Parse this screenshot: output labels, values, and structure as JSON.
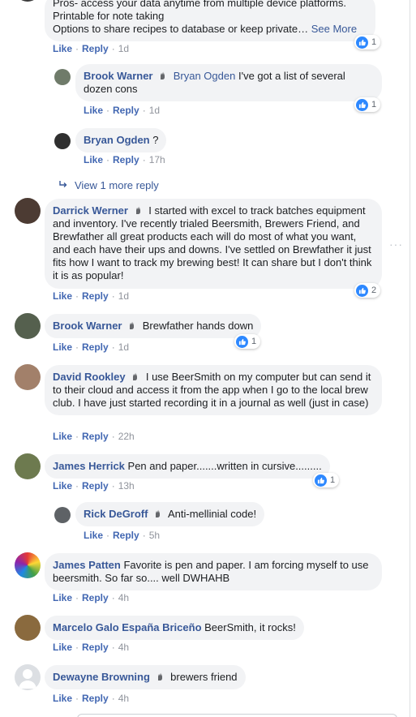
{
  "labels": {
    "like": "Like",
    "reply": "Reply",
    "see_more": "See More",
    "sep": "·"
  },
  "top_comment": {
    "line1": "Pros- access your data anytime from multiple device platforms.",
    "line2": "Printable for note taking",
    "line3": "Options to share recipes to database or keep private…",
    "time": "1d",
    "reactions": "1"
  },
  "reply1": {
    "author": "Brook Warner",
    "mention": "Bryan Ogden",
    "text": "I've got a list of several dozen cons",
    "time": "1d",
    "reactions": "1"
  },
  "reply2": {
    "author": "Bryan Ogden",
    "text": "?",
    "time": "17h"
  },
  "view_more": "View 1 more reply",
  "comments": [
    {
      "author": "Darrick Werner",
      "text": "I started with excel to track batches equipment and inventory. I've recently trialed Beersmith, Brewers Friend, and Brewfather all great products each will do most of what you want, and each have their ups and downs. I've settled on Brewfather it just fits how I want to track my brewing best! It can share but I don't think it is as popular!",
      "time": "1d",
      "reactions": "2"
    },
    {
      "author": "Brook Warner",
      "text": "Brewfather hands down",
      "time": "1d",
      "reactions": "1"
    },
    {
      "author": "David Rookley",
      "text": "I use BeerSmith on my computer but can send it to their cloud and access it from the app when I go to the local brew club. I have just started recording it in a journal as well (just in case)",
      "time": "22h"
    },
    {
      "author": "James Herrick",
      "text": "Pen and paper.......written in cursive.........",
      "time": "13h",
      "reactions": "1"
    },
    {
      "author": "Rick DeGroff",
      "text": "Anti-mellinial code!",
      "time": "5h"
    },
    {
      "author": "James Patten",
      "text": "Favorite is pen and paper. I am forcing myself to use beersmith. So far so.... well DWHAHB",
      "time": "4h"
    },
    {
      "author": "Marcelo Galo España Briceño",
      "text": "BeerSmith, it rocks!",
      "time": "4h"
    },
    {
      "author": "Dewayne Browning",
      "text": "brewers friend",
      "time": "4h"
    }
  ],
  "colors": {
    "link": "#385898",
    "action": "#4267b2",
    "bubble": "#f2f3f5",
    "like": "#2d88ff"
  }
}
